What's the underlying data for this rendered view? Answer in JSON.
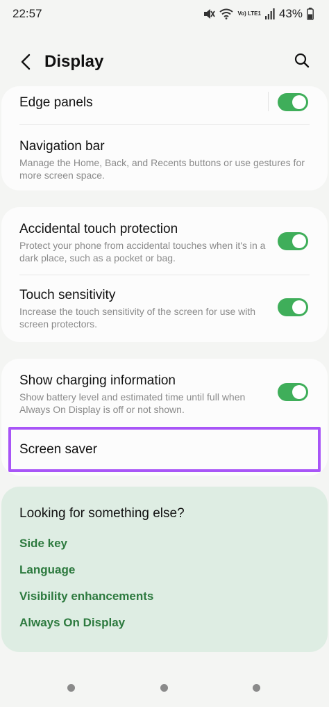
{
  "status_bar": {
    "time": "22:57",
    "network_label": "Vo) LTE1",
    "battery": "43%"
  },
  "header": {
    "title": "Display"
  },
  "card1": {
    "edge_panels": {
      "title": "Edge panels",
      "enabled": true
    },
    "navigation_bar": {
      "title": "Navigation bar",
      "subtitle": "Manage the Home, Back, and Recents buttons or use gestures for more screen space."
    }
  },
  "card2": {
    "accidental_touch": {
      "title": "Accidental touch protection",
      "subtitle": "Protect your phone from accidental touches when it's in a dark place, such as a pocket or bag.",
      "enabled": true
    },
    "touch_sensitivity": {
      "title": "Touch sensitivity",
      "subtitle": "Increase the touch sensitivity of the screen for use with screen protectors.",
      "enabled": true
    }
  },
  "card3": {
    "charging_info": {
      "title": "Show charging information",
      "subtitle": "Show battery level and estimated time until full when Always On Display is off or not shown.",
      "enabled": true
    },
    "screen_saver": {
      "title": "Screen saver"
    }
  },
  "suggestions": {
    "title": "Looking for something else?",
    "links": [
      "Side key",
      "Language",
      "Visibility enhancements",
      "Always On Display"
    ]
  },
  "colors": {
    "toggle_on": "#3fae5a",
    "link": "#2d7a3f",
    "highlight": "#a855f7",
    "suggest_bg": "#deede3"
  },
  "icons": [
    "back-arrow-icon",
    "search-icon",
    "mute-icon",
    "wifi-icon",
    "signal-icon"
  ]
}
